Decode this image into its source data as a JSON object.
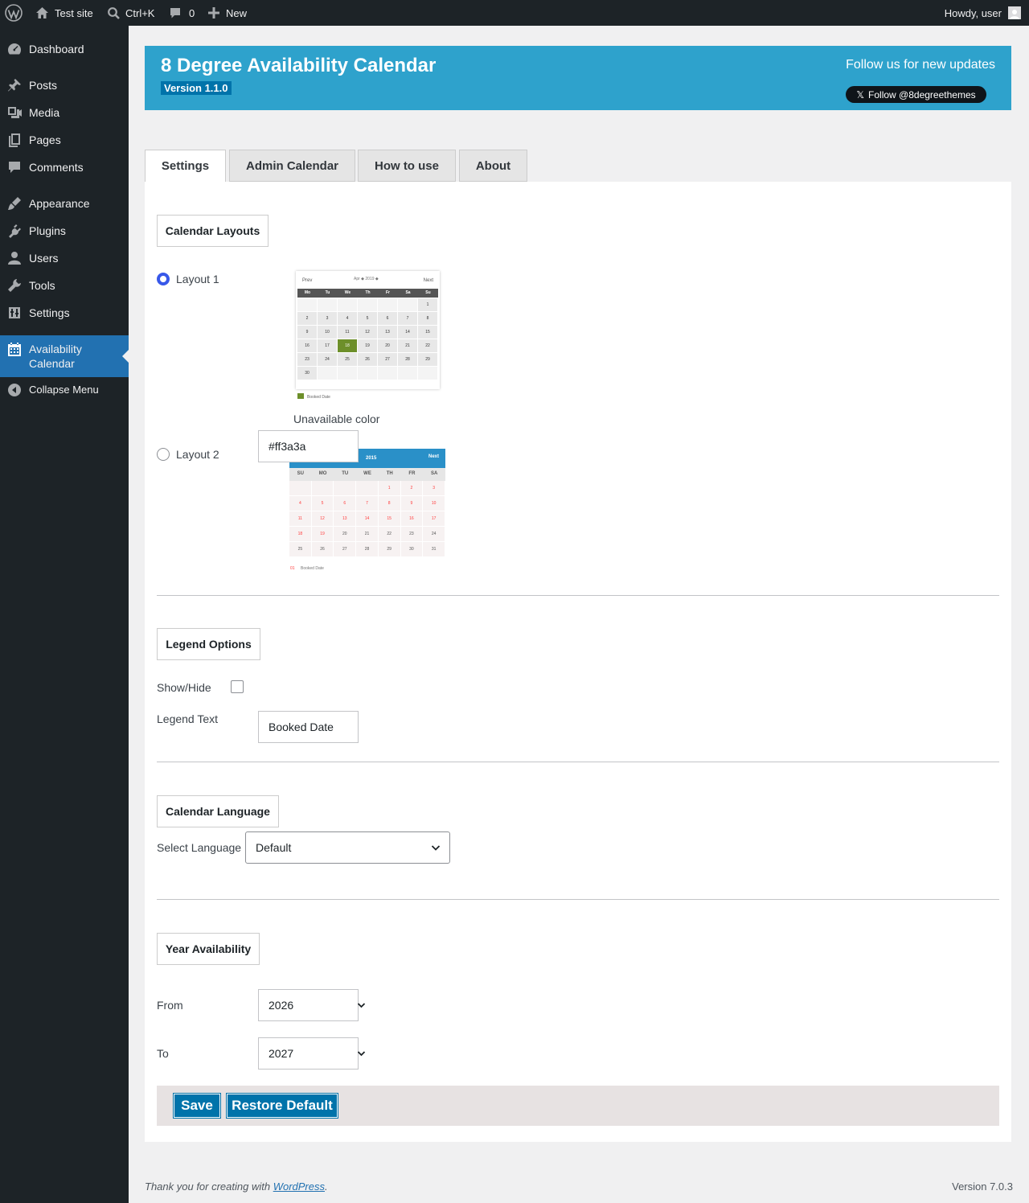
{
  "adminbar": {
    "site_name": "Test site",
    "search_shortcut": "Ctrl+K",
    "comments_count": "0",
    "new_label": "New",
    "howdy": "Howdy, user"
  },
  "sidebar": {
    "items": [
      {
        "label": "Dashboard",
        "icon": "dashboard-icon"
      },
      {
        "label": "Posts",
        "icon": "pushpin-icon"
      },
      {
        "label": "Media",
        "icon": "media-icon"
      },
      {
        "label": "Pages",
        "icon": "pages-icon"
      },
      {
        "label": "Comments",
        "icon": "comment-icon"
      },
      {
        "label": "Appearance",
        "icon": "paintbrush-icon"
      },
      {
        "label": "Plugins",
        "icon": "plugin-icon"
      },
      {
        "label": "Users",
        "icon": "user-icon"
      },
      {
        "label": "Tools",
        "icon": "wrench-icon"
      },
      {
        "label": "Settings",
        "icon": "settings-icon"
      },
      {
        "label": "Availability Calendar",
        "icon": "calendar-icon",
        "current": true
      }
    ],
    "collapse_label": "Collapse Menu"
  },
  "header": {
    "title": "8 Degree Availability Calendar",
    "version": "Version 1.1.0",
    "follow_text": "Follow us for new updates",
    "follow_button": "Follow @8degreethemes"
  },
  "tabs": [
    {
      "label": "Settings",
      "active": true
    },
    {
      "label": "Admin Calendar"
    },
    {
      "label": "How to use"
    },
    {
      "label": "About"
    }
  ],
  "layouts_section": {
    "title": "Calendar Layouts",
    "layout1_label": "Layout 1",
    "layout2_label": "Layout 2",
    "selected": "Layout 1",
    "unavailable_label": "Unavailable color",
    "unavailable_value": "#ff3a3a",
    "thumb1": {
      "prev": "Prev",
      "next": "Next",
      "month": "Apr",
      "year": "2019",
      "days": [
        "Mo",
        "Tu",
        "We",
        "Th",
        "Fr",
        "Sa",
        "Su"
      ],
      "weeks": [
        [
          "",
          "",
          "",
          "",
          "",
          "",
          "1"
        ],
        [
          "2",
          "3",
          "4",
          "5",
          "6",
          "7",
          "8"
        ],
        [
          "9",
          "10",
          "11",
          "12",
          "13",
          "14",
          "15"
        ],
        [
          "16",
          "17",
          "18",
          "19",
          "20",
          "21",
          "22"
        ],
        [
          "23",
          "24",
          "25",
          "26",
          "27",
          "28",
          "29"
        ],
        [
          "30",
          "",
          "",
          "",
          "",
          "",
          ""
        ]
      ],
      "booked": "18",
      "legend": "Booked Date",
      "booked_color": "#6d8f2a"
    },
    "thumb2": {
      "next": "Next",
      "year": "2015",
      "days": [
        "SU",
        "MO",
        "TU",
        "WE",
        "TH",
        "FR",
        "SA"
      ],
      "weeks": [
        [
          "",
          "",
          "",
          "",
          "1",
          "2",
          "3"
        ],
        [
          "4",
          "5",
          "6",
          "7",
          "8",
          "9",
          "10"
        ],
        [
          "11",
          "12",
          "13",
          "14",
          "15",
          "16",
          "17"
        ],
        [
          "18",
          "19",
          "20",
          "21",
          "22",
          "23",
          "24"
        ],
        [
          "25",
          "26",
          "27",
          "28",
          "29",
          "30",
          "31"
        ]
      ],
      "legend_num": "01",
      "legend": "Booked Date",
      "header_color": "#2a90c8"
    }
  },
  "legend_section": {
    "title": "Legend Options",
    "show_hide_label": "Show/Hide",
    "show_hide_checked": false,
    "legend_text_label": "Legend Text",
    "legend_text_value": "Booked Date"
  },
  "language_section": {
    "title": "Calendar Language",
    "select_label": "Select Language",
    "selected": "Default"
  },
  "year_section": {
    "title": "Year Availability",
    "from_label": "From",
    "from_value": "2026",
    "to_label": "To",
    "to_value": "2027"
  },
  "actions": {
    "save": "Save",
    "restore": "Restore Default"
  },
  "footer": {
    "thanks_prefix": "Thank you for creating with ",
    "wordpress_link": "WordPress",
    "suffix": ".",
    "version": "Version 7.0.3"
  },
  "colors": {
    "admin_dark": "#1d2327",
    "menu_current": "#2271b1",
    "banner": "#2ea2cc",
    "button": "#0073aa"
  }
}
